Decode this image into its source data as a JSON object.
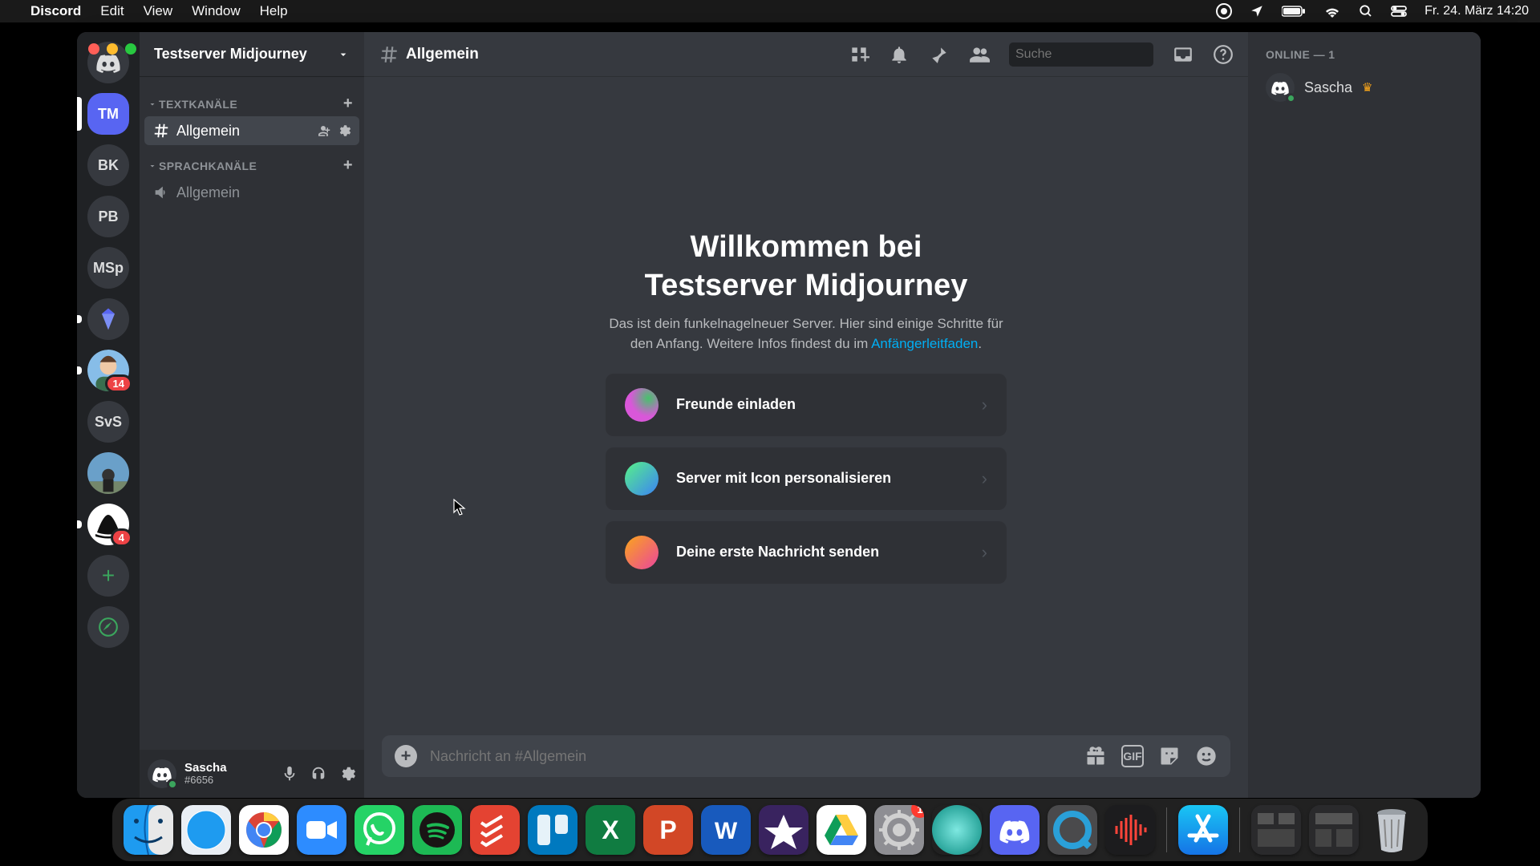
{
  "mac_menu": {
    "app": "Discord",
    "items": [
      "Edit",
      "View",
      "Window",
      "Help"
    ],
    "clock": "Fr. 24. März  14:20"
  },
  "server_name": "Testserver Midjourney",
  "servers": [
    {
      "id": "home",
      "type": "home"
    },
    {
      "id": "tm",
      "label": "TM",
      "active": true
    },
    {
      "id": "bk",
      "label": "BK"
    },
    {
      "id": "pb",
      "label": "PB"
    },
    {
      "id": "msp",
      "label": "MSp"
    },
    {
      "id": "gem",
      "type": "icon-gem",
      "notif": true
    },
    {
      "id": "av1",
      "type": "avatar",
      "badge": "14",
      "notif": true
    },
    {
      "id": "svs",
      "label": "SvS"
    },
    {
      "id": "av2",
      "type": "avatar-photo"
    },
    {
      "id": "mj",
      "type": "icon-ship",
      "badge": "4",
      "notif": true
    }
  ],
  "channel_categories": [
    {
      "name": "TEXTKANÄLE",
      "channels": [
        {
          "name": "Allgemein",
          "type": "text",
          "selected": true
        }
      ]
    },
    {
      "name": "SPRACHKANÄLE",
      "channels": [
        {
          "name": "Allgemein",
          "type": "voice"
        }
      ]
    }
  ],
  "user": {
    "name": "Sascha",
    "tag": "#6656"
  },
  "chat_header": {
    "channel": "Allgemein",
    "search_placeholder": "Suche"
  },
  "welcome": {
    "title_l1": "Willkommen bei",
    "title_l2": "Testserver Midjourney",
    "subtitle_pre": "Das ist dein funkelnagelneuer Server. Hier sind einige Schritte für den Anfang. Weitere Infos findest du im ",
    "subtitle_link": "Anfängerleitfaden",
    "cards": [
      {
        "label": "Freunde einladen",
        "icon": "invite"
      },
      {
        "label": "Server mit Icon personalisieren",
        "icon": "personalize"
      },
      {
        "label": "Deine erste Nachricht senden",
        "icon": "first"
      }
    ]
  },
  "composer": {
    "placeholder": "Nachricht an #Allgemein",
    "gif_label": "GIF"
  },
  "members": {
    "header": "ONLINE — 1",
    "list": [
      {
        "name": "Sascha",
        "owner": true
      }
    ]
  },
  "dock": {
    "badge_settings": "1",
    "apps": [
      "finder",
      "safari",
      "chrome",
      "zoom",
      "whatsapp",
      "spotify",
      "todoist",
      "trello",
      "excel",
      "powerpoint",
      "word",
      "imovie",
      "drive",
      "settings",
      "craft",
      "discord",
      "quicktime",
      "voice"
    ]
  }
}
